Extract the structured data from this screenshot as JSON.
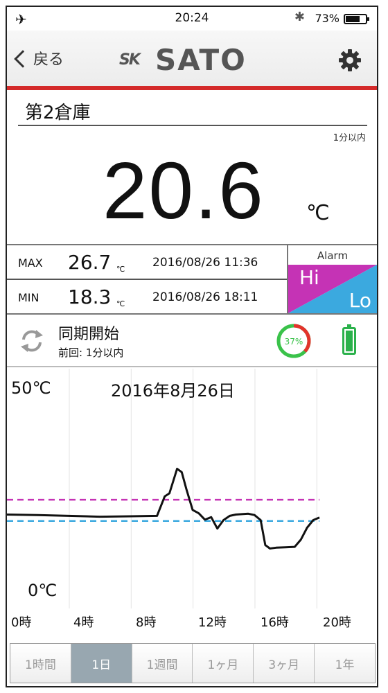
{
  "status_bar": {
    "time": "20:24",
    "battery": "73%",
    "battery_level": 0.73
  },
  "nav": {
    "back_label": "戻る",
    "logo_mark": "SK",
    "logo_text": "SATO"
  },
  "sensor": {
    "location": "第2倉庫",
    "updated": "1分以内",
    "temperature": "20.6",
    "unit": "℃"
  },
  "stats": {
    "max_label": "MAX",
    "max_value": "26.7",
    "max_unit": "℃",
    "max_time": "2016/08/26 11:36",
    "min_label": "MIN",
    "min_value": "18.3",
    "min_unit": "℃",
    "min_time": "2016/08/26 18:11"
  },
  "alarm": {
    "title": "Alarm",
    "hi": "Hi",
    "lo": "Lo",
    "hi_color": "#c533b5",
    "lo_color": "#3ba9df"
  },
  "sync": {
    "title": "同期開始",
    "last": "前回: 1分以内",
    "progress_label": "37%",
    "progress": 0.37
  },
  "chart_data": {
    "type": "line",
    "title": "2016年8月26日",
    "ylabel_max": "50℃",
    "ylabel_min": "0℃",
    "ylim": [
      0,
      50
    ],
    "xlim": [
      0,
      24
    ],
    "x_ticks": [
      "0時",
      "4時",
      "8時",
      "12時",
      "16時",
      "20時"
    ],
    "x_tick_values": [
      0,
      4,
      8,
      12,
      16,
      20
    ],
    "hi_threshold": 24,
    "lo_threshold": 19,
    "hi_color": "#c533b5",
    "lo_color": "#3ba9df",
    "series": [
      {
        "x": [
          0,
          2,
          4,
          6,
          8,
          9.7,
          10.2,
          10.5,
          11,
          11.3,
          11.6,
          12,
          12.4,
          12.8,
          13.2,
          13.6,
          14,
          14.4,
          14.8,
          15.2,
          15.6,
          16,
          16.4,
          16.7,
          17,
          17.4,
          18,
          18.6,
          19,
          19.4,
          19.8,
          20.2
        ],
        "y": [
          20.5,
          20.4,
          20.2,
          20.0,
          20.1,
          20.2,
          24.8,
          25.5,
          31.3,
          30.5,
          26.5,
          21.6,
          20.8,
          19.3,
          19.9,
          17.2,
          19.2,
          20.2,
          20.5,
          20.6,
          20.7,
          20.4,
          19.2,
          13.3,
          12.5,
          12.7,
          12.8,
          12.9,
          14.6,
          17.4,
          19.2,
          19.8
        ]
      }
    ]
  },
  "range_tabs": [
    "1時間",
    "1日",
    "1週間",
    "1ヶ月",
    "3ヶ月",
    "1年"
  ],
  "active_tab": "1日"
}
